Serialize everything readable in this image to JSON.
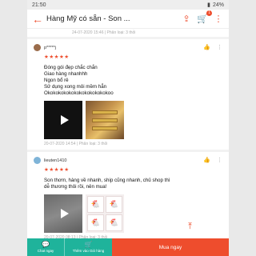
{
  "status_bar": {
    "time": "21:50",
    "battery": "24%"
  },
  "header": {
    "title": "Hàng Mỹ có sẵn - Son ...",
    "cart_count": "1",
    "back_icon": "arrow-left-icon",
    "share_icon": "share-icon",
    "cart_icon": "cart-icon"
  },
  "top_meta": "24-07-2020 15:46 | Phân loại: 3 thỏi",
  "reviews": [
    {
      "username": "p*****j",
      "stars": "★★★★★",
      "lines": [
        "Đóng gói đẹp chắc chắn",
        "Giao hàng nhanhhh",
        "Ngon bổ rẻ",
        "Sử dụng xong môi mềm hẳn",
        "Okokokokokokokokokokokokoo"
      ],
      "date": "20-07-2020 14:54 | Phân loại: 3 thỏi"
    },
    {
      "username": "lieuten1410",
      "stars": "★★★★★",
      "lines": [
        "Son thơm, hàng về nhanh, ship cũng nhanh, chủ shop thì",
        "dễ thương thôi rồi, nên mua!"
      ],
      "date": "20-07-2020 08:13 | Phân loại: 3 thỏi"
    }
  ],
  "bottom_bar": {
    "chat_label": "Chat ngay",
    "add_cart_label": "Thêm vào Giỏ hàng",
    "buy_label": "Mua ngay"
  },
  "colors": {
    "accent": "#ee4d2d",
    "teal": "#1fb39b"
  }
}
